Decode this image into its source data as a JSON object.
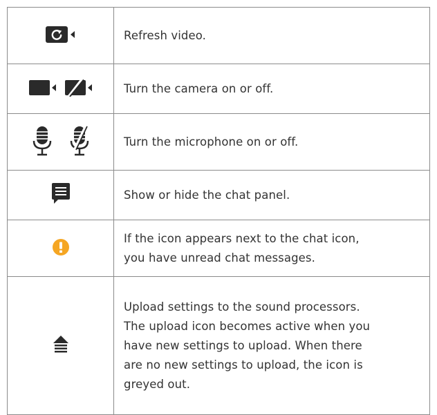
{
  "rows": [
    {
      "icons": [
        "refresh-video-icon"
      ],
      "lines": [
        "Refresh video."
      ]
    },
    {
      "icons": [
        "camera-icon",
        "camera-off-icon"
      ],
      "lines": [
        "Turn the camera on or off."
      ]
    },
    {
      "icons": [
        "microphone-icon",
        "microphone-off-icon"
      ],
      "lines": [
        "Turn the microphone on or off."
      ]
    },
    {
      "icons": [
        "chat-icon"
      ],
      "lines": [
        "Show or hide the chat panel."
      ]
    },
    {
      "icons": [
        "unread-alert-icon"
      ],
      "lines": [
        "If the icon appears next to the chat icon,",
        "you have unread chat messages."
      ]
    },
    {
      "icons": [
        "upload-icon"
      ],
      "lines": [
        "Upload settings to the sound processors.",
        "The upload icon becomes active when you",
        "have new settings to upload. When there",
        "are no new settings to upload, the icon is",
        "greyed out."
      ]
    }
  ],
  "colors": {
    "icon_dark": "#2a2a2a",
    "alert_orange": "#f5a623",
    "border": "#8a8a8a",
    "text": "#333333"
  }
}
